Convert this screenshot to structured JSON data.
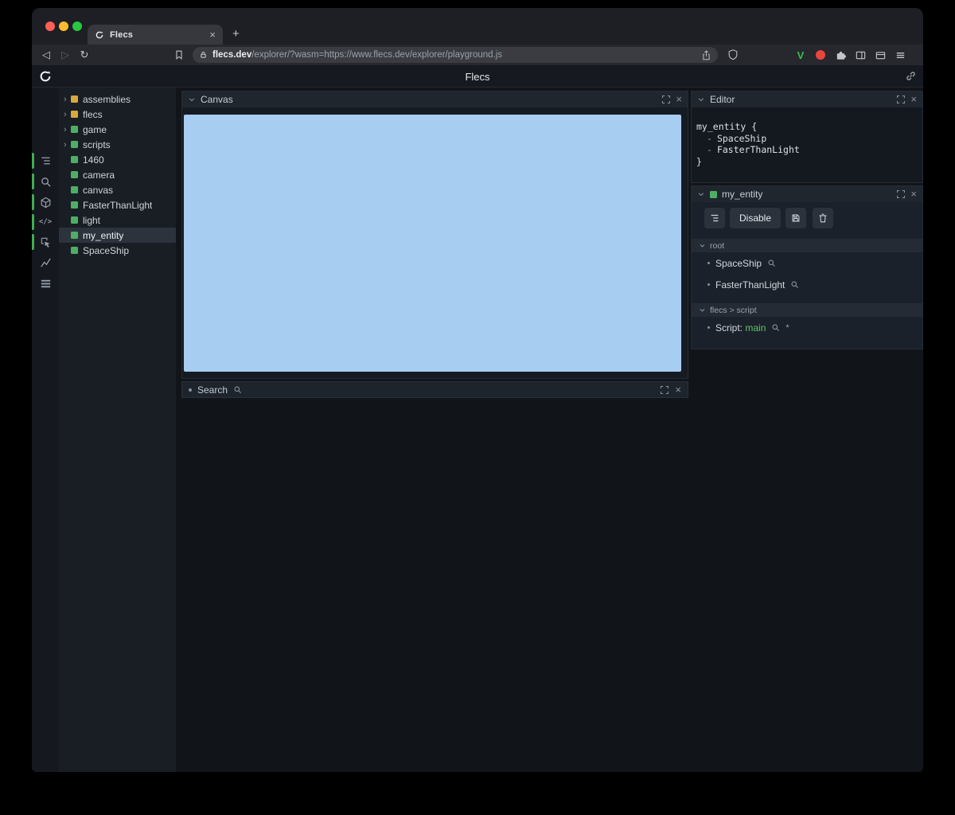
{
  "browser": {
    "tab_title": "Flecs",
    "url_domain": "flecs.dev",
    "url_path": "/explorer/?wasm=https://www.flecs.dev/explorer/playground.js",
    "extensions": {
      "v_label": "V"
    }
  },
  "icons": {
    "close": "×",
    "plus": "+",
    "back": "◁",
    "forward": "▷",
    "reload": "↻",
    "tree_expand": "›",
    "code": "</>",
    "asterisk": "*"
  },
  "colors": {
    "accent_green": "#4fae66",
    "accent_yellow": "#d6a83e",
    "canvas_blue": "#a7cdf1",
    "rail_indicator": "#3fae53"
  },
  "app": {
    "title": "Flecs",
    "tree": {
      "selected": "my_entity",
      "items": [
        {
          "label": "assemblies"
        },
        {
          "label": "flecs"
        },
        {
          "label": "game"
        },
        {
          "label": "scripts"
        },
        {
          "label": "1460"
        },
        {
          "label": "camera"
        },
        {
          "label": "canvas"
        },
        {
          "label": "FasterThanLight"
        },
        {
          "label": "light"
        },
        {
          "label": "my_entity"
        },
        {
          "label": "SpaceShip"
        }
      ]
    },
    "canvas_panel": {
      "title": "Canvas"
    },
    "search_panel": {
      "title": "Search"
    },
    "editor_panel": {
      "title": "Editor",
      "line1": "my_entity {",
      "dash": "-",
      "comp1": "SpaceShip",
      "comp2": "FasterThanLight",
      "line4": "}"
    },
    "entity_panel": {
      "title": "my_entity",
      "disable_label": "Disable",
      "root_section": "root",
      "root_items": [
        "SpaceShip",
        "FasterThanLight"
      ],
      "script_section": "flecs > script",
      "script_item_prefix": "Script:",
      "script_item_value": "main"
    }
  }
}
